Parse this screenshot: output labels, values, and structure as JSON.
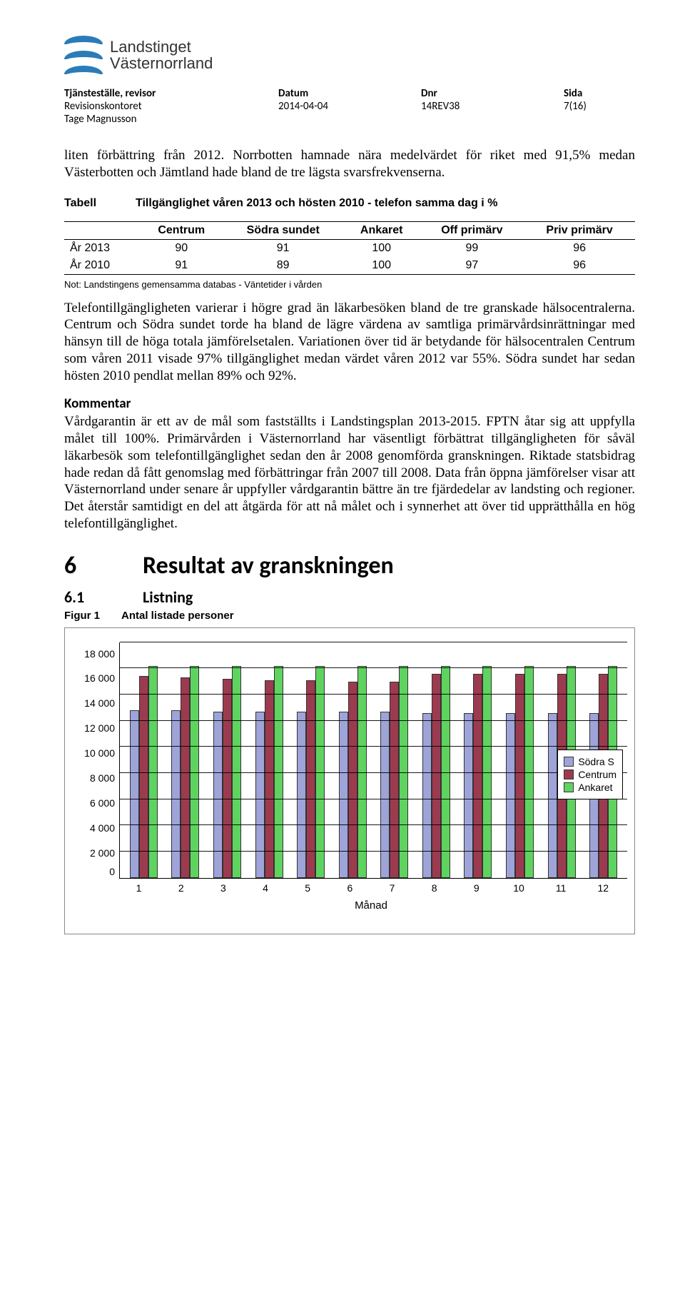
{
  "logo_text_line1": "Landstinget",
  "logo_text_line2": "Västernorrland",
  "meta": {
    "h1": "Tjänsteställe, revisor",
    "h2": "Datum",
    "h3": "Dnr",
    "h4": "Sida",
    "v1a": "Revisionskontoret",
    "v1b": "Tage Magnusson",
    "v2": "2014-04-04",
    "v3": "14REV38",
    "v4": "7(16)"
  },
  "para_intro": "liten förbättring från 2012. Norrbotten hamnade nära medelvärdet för riket med 91,5% medan Västerbotten och Jämtland hade bland de tre lägsta svarsfrekvenserna.",
  "tabell_label": "Tabell",
  "tabell_title": "Tillgänglighet våren 2013 och hösten 2010 - telefon samma dag i %",
  "table": {
    "headers": [
      "",
      "Centrum",
      "Södra sundet",
      "Ankaret",
      "Off primärv",
      "Priv primärv"
    ],
    "rows": [
      [
        "År 2013",
        "90",
        "91",
        "100",
        "99",
        "96"
      ],
      [
        "År 2010",
        "91",
        "89",
        "100",
        "97",
        "96"
      ]
    ],
    "note": "Not: Landstingens gemensamma databas - Väntetider i vården"
  },
  "para1": "Telefontillgängligheten varierar i högre grad än läkarbesöken bland de tre granskade hälsocentralerna. Centrum och Södra sundet torde ha bland de lägre värdena av samtliga primärvårdsinrättningar med hänsyn till de höga totala jämförelsetalen. Variationen över tid är betydande för hälsocentralen Centrum som våren 2011 visade 97% tillgänglighet medan värdet våren 2012 var 55%. Södra sundet har sedan hösten 2010 pendlat mellan 89% och 92%.",
  "kommentar_head": "Kommentar",
  "para2": "Vårdgarantin är ett av de mål som fastställts i Landstingsplan 2013-2015. FPTN åtar sig att uppfylla målet till 100%. Primärvården i Västernorrland har väsentligt förbättrat tillgängligheten för såväl läkarbesök som telefontillgänglighet sedan den år 2008 genomförda granskningen. Riktade statsbidrag hade redan då fått genomslag med förbättringar från 2007 till 2008. Data från öppna jämförelser visar att Västernorrland under senare år uppfyller vårdgarantin bättre än tre fjärdedelar av landsting och regioner. Det återstår samtidigt en del att åtgärda för att nå målet och i synnerhet att över tid upprätthålla en hög telefontillgänglighet.",
  "h1_num": "6",
  "h1_text": "Resultat av granskningen",
  "h2_num": "6.1",
  "h2_text": "Listning",
  "figur_label": "Figur 1",
  "figur_title": "Antal listade personer",
  "chart_data": {
    "type": "bar",
    "title": "Antal listade personer",
    "xlabel": "Månad",
    "ylabel": "",
    "ylim": [
      0,
      18000
    ],
    "yticks": [
      0,
      2000,
      4000,
      6000,
      8000,
      10000,
      12000,
      14000,
      16000,
      18000
    ],
    "ytick_labels": [
      "0",
      "2 000",
      "4 000",
      "6 000",
      "8 000",
      "10 000",
      "12 000",
      "14 000",
      "16 000",
      "18 000"
    ],
    "categories": [
      "1",
      "2",
      "3",
      "4",
      "5",
      "6",
      "7",
      "8",
      "9",
      "10",
      "11",
      "12"
    ],
    "series": [
      {
        "name": "Södra S",
        "color": "#9ea4d8",
        "values": [
          12800,
          12800,
          12700,
          12700,
          12700,
          12700,
          12700,
          12600,
          12600,
          12600,
          12600,
          12600
        ]
      },
      {
        "name": "Centrum",
        "color": "#9c3b4f",
        "values": [
          15400,
          15300,
          15200,
          15100,
          15100,
          15000,
          15000,
          15600,
          15600,
          15600,
          15600,
          15600
        ]
      },
      {
        "name": "Ankaret",
        "color": "#5fd35f",
        "values": [
          16200,
          16200,
          16200,
          16200,
          16200,
          16200,
          16200,
          16200,
          16200,
          16200,
          16200,
          16200
        ]
      }
    ],
    "legend_position": "right"
  }
}
